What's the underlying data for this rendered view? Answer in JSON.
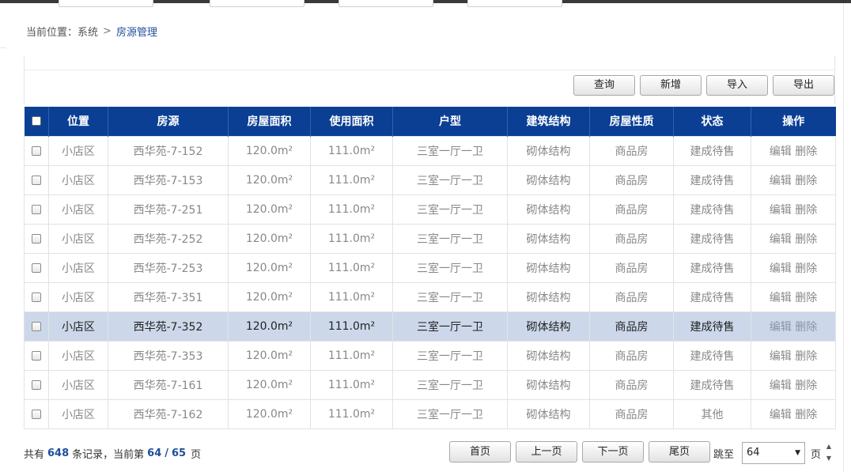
{
  "breadcrumb": {
    "prefix": "当前位置：",
    "root": "系统",
    "separator": ">",
    "current": "房源管理"
  },
  "toolbar": {
    "query_label": "查询",
    "add_label": "新增",
    "import_label": "导入",
    "export_label": "导出"
  },
  "table": {
    "headers": [
      "位置",
      "房源",
      "房屋面积",
      "使用面积",
      "户型",
      "建筑结构",
      "房屋性质",
      "状态",
      "操作"
    ],
    "edit_label": "编辑",
    "delete_label": "删除",
    "rows": [
      {
        "location": "小店区",
        "house": "西华苑-7-152",
        "area": "120.0m²",
        "usable": "111.0m²",
        "layout": "三室一厅一卫",
        "structure": "砌体结构",
        "nature": "商品房",
        "status": "建成待售",
        "selected": false
      },
      {
        "location": "小店区",
        "house": "西华苑-7-153",
        "area": "120.0m²",
        "usable": "111.0m²",
        "layout": "三室一厅一卫",
        "structure": "砌体结构",
        "nature": "商品房",
        "status": "建成待售",
        "selected": false
      },
      {
        "location": "小店区",
        "house": "西华苑-7-251",
        "area": "120.0m²",
        "usable": "111.0m²",
        "layout": "三室一厅一卫",
        "structure": "砌体结构",
        "nature": "商品房",
        "status": "建成待售",
        "selected": false
      },
      {
        "location": "小店区",
        "house": "西华苑-7-252",
        "area": "120.0m²",
        "usable": "111.0m²",
        "layout": "三室一厅一卫",
        "structure": "砌体结构",
        "nature": "商品房",
        "status": "建成待售",
        "selected": false
      },
      {
        "location": "小店区",
        "house": "西华苑-7-253",
        "area": "120.0m²",
        "usable": "111.0m²",
        "layout": "三室一厅一卫",
        "structure": "砌体结构",
        "nature": "商品房",
        "status": "建成待售",
        "selected": false
      },
      {
        "location": "小店区",
        "house": "西华苑-7-351",
        "area": "120.0m²",
        "usable": "111.0m²",
        "layout": "三室一厅一卫",
        "structure": "砌体结构",
        "nature": "商品房",
        "status": "建成待售",
        "selected": false
      },
      {
        "location": "小店区",
        "house": "西华苑-7-352",
        "area": "120.0m²",
        "usable": "111.0m²",
        "layout": "三室一厅一卫",
        "structure": "砌体结构",
        "nature": "商品房",
        "status": "建成待售",
        "selected": true
      },
      {
        "location": "小店区",
        "house": "西华苑-7-353",
        "area": "120.0m²",
        "usable": "111.0m²",
        "layout": "三室一厅一卫",
        "structure": "砌体结构",
        "nature": "商品房",
        "status": "建成待售",
        "selected": false
      },
      {
        "location": "小店区",
        "house": "西华苑-7-161",
        "area": "120.0m²",
        "usable": "111.0m²",
        "layout": "三室一厅一卫",
        "structure": "砌体结构",
        "nature": "商品房",
        "status": "建成待售",
        "selected": false
      },
      {
        "location": "小店区",
        "house": "西华苑-7-162",
        "area": "120.0m²",
        "usable": "111.0m²",
        "layout": "三室一厅一卫",
        "structure": "砌体结构",
        "nature": "商品房",
        "status": "其他",
        "selected": false
      }
    ]
  },
  "pager": {
    "total_prefix": "共有",
    "total": "648",
    "total_suffix": "条记录，当前第",
    "current_page": "64",
    "page_sep": "/",
    "total_pages": "65",
    "page_suffix": "页",
    "first_label": "首页",
    "prev_label": "上一页",
    "next_label": "下一页",
    "last_label": "尾页",
    "jump_label": "跳至",
    "jump_value": "64",
    "page_label": "页"
  },
  "colors": {
    "header_bg": "#0b3f94",
    "selected_row_bg": "#ccd8ea",
    "accent_text": "#1f4f9c"
  }
}
